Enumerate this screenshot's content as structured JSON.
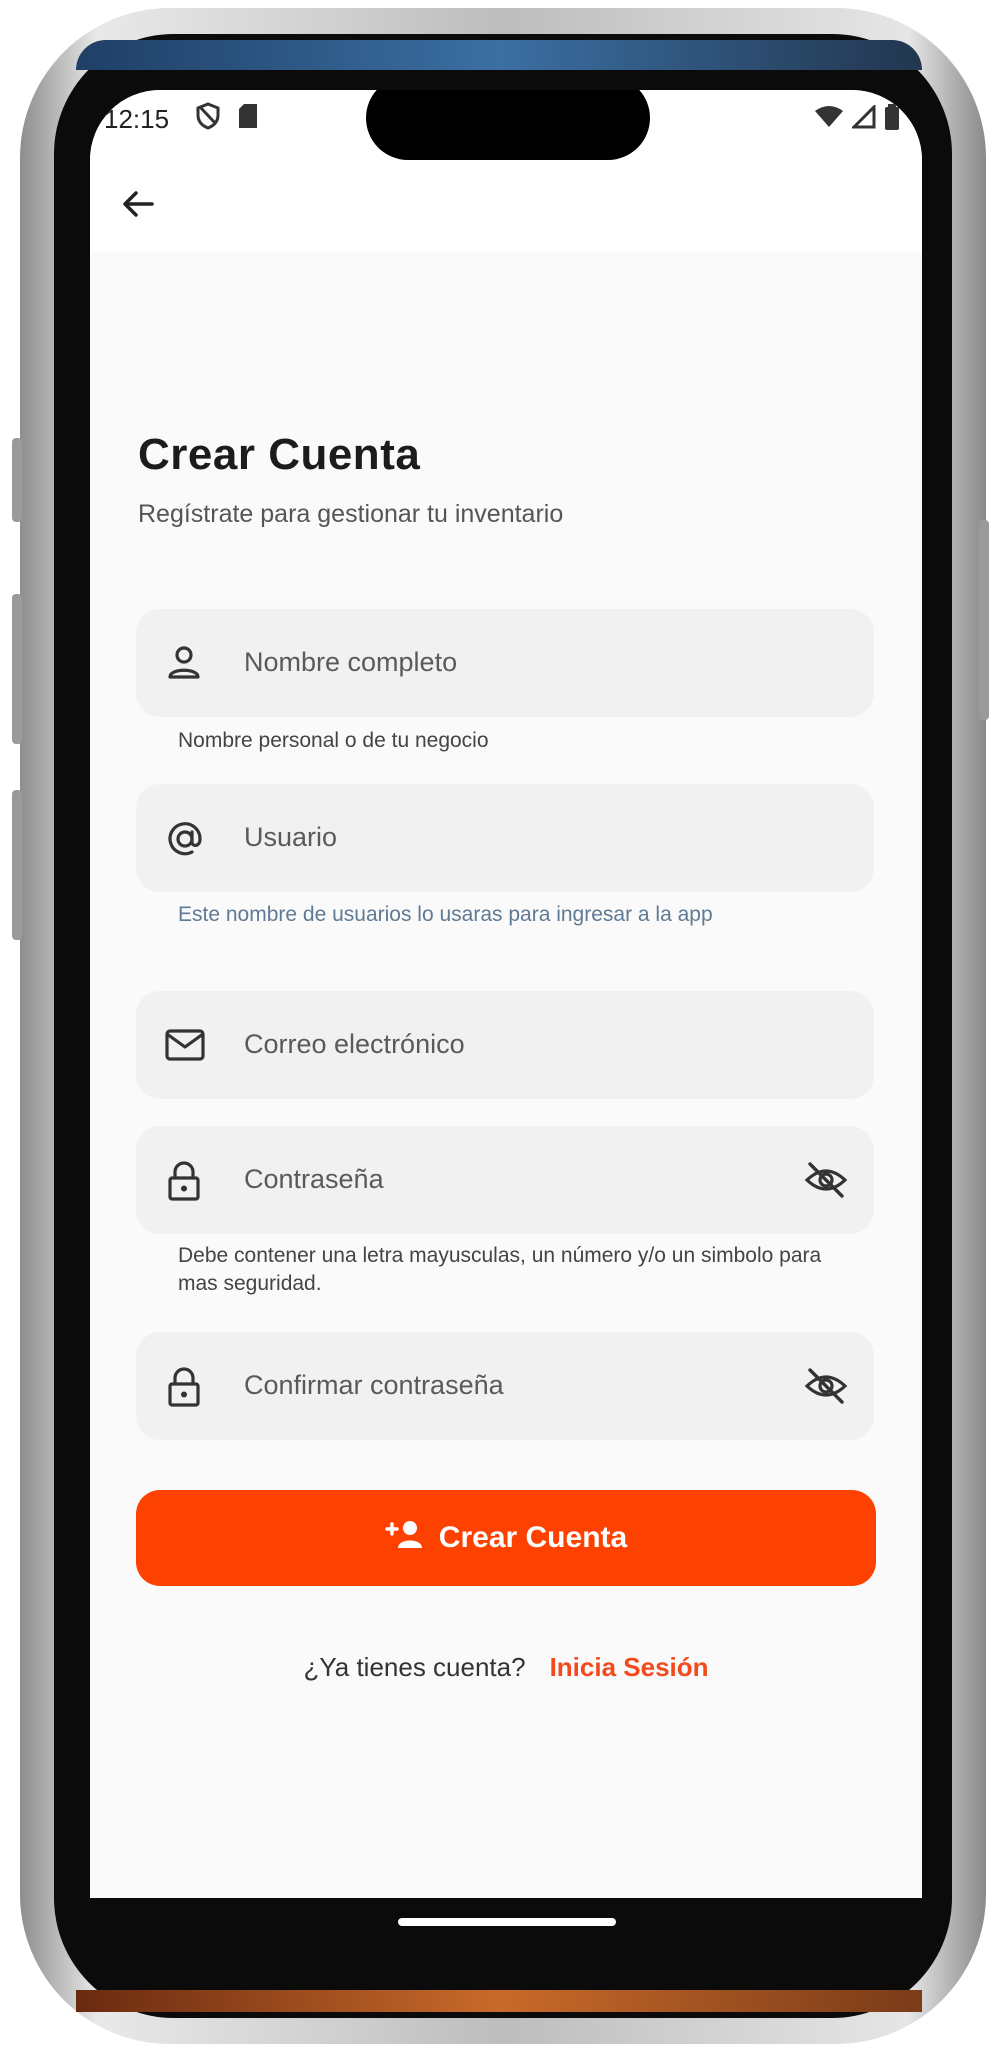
{
  "status_bar": {
    "time": "12:15",
    "left_icons": [
      "shield-icon",
      "sd-card-icon"
    ],
    "right_icons": [
      "wifi-icon",
      "signal-icon",
      "battery-icon"
    ]
  },
  "appbar": {
    "back_icon": "arrow-left-icon"
  },
  "header": {
    "title": "Crear Cuenta",
    "subtitle": "Regístrate para gestionar tu inventario"
  },
  "form": {
    "full_name": {
      "label": "Nombre completo",
      "icon": "person-icon",
      "helper": "Nombre personal o de tu negocio"
    },
    "username": {
      "label": "Usuario",
      "icon": "at-icon",
      "helper": "Este nombre de usuarios lo usaras para ingresar a la app"
    },
    "email": {
      "label": "Correo electrónico",
      "icon": "mail-icon"
    },
    "password": {
      "label": "Contraseña",
      "icon": "lock-icon",
      "toggle_icon": "eye-off-icon",
      "helper": "Debe contener una letra mayusculas, un número y/o un simbolo para mas seguridad."
    },
    "confirm_password": {
      "label": "Confirmar contraseña",
      "icon": "lock-icon",
      "toggle_icon": "eye-off-icon"
    }
  },
  "cta": {
    "label": "Crear Cuenta",
    "icon": "person-add-icon"
  },
  "footer": {
    "prompt": "¿Ya tienes cuenta?",
    "link": "Inicia Sesión"
  },
  "colors": {
    "accent": "#FC4100",
    "link": "#F24A1C",
    "helper_blue": "#5F7A94",
    "field_bg": "#F1F1F1",
    "background": "#FAFAFA"
  }
}
